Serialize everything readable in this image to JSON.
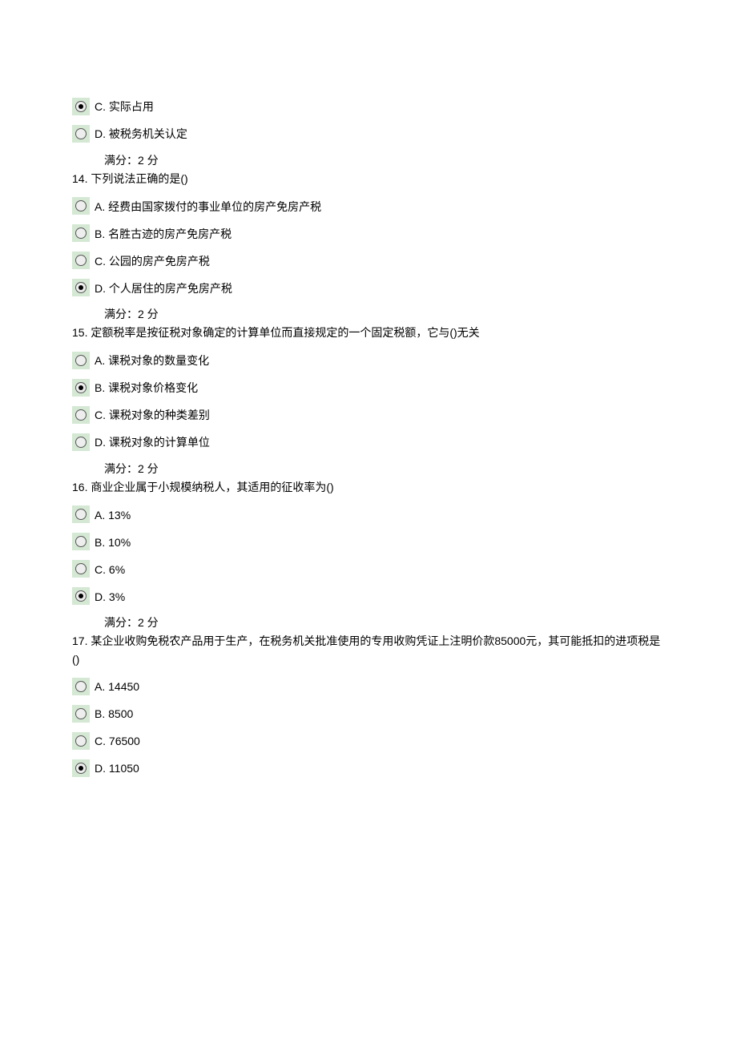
{
  "partialQuestion": {
    "options": [
      {
        "letter": "C",
        "text": "实际占用",
        "selected": true
      },
      {
        "letter": "D",
        "text": "被税务机关认定",
        "selected": false
      }
    ],
    "score": "满分：2 分"
  },
  "questions": [
    {
      "number": "14",
      "stem": "下列说法正确的是()",
      "options": [
        {
          "letter": "A",
          "text": "经费由国家拨付的事业单位的房产免房产税",
          "selected": false
        },
        {
          "letter": "B",
          "text": "名胜古迹的房产免房产税",
          "selected": false
        },
        {
          "letter": "C",
          "text": "公园的房产免房产税",
          "selected": false
        },
        {
          "letter": "D",
          "text": "个人居住的房产免房产税",
          "selected": true
        }
      ],
      "score": "满分：2 分"
    },
    {
      "number": "15",
      "stem": "定额税率是按征税对象确定的计算单位而直接规定的一个固定税额，它与()无关",
      "options": [
        {
          "letter": "A",
          "text": "课税对象的数量变化",
          "selected": false
        },
        {
          "letter": "B",
          "text": "课税对象价格变化",
          "selected": true
        },
        {
          "letter": "C",
          "text": "课税对象的种类差别",
          "selected": false
        },
        {
          "letter": "D",
          "text": "课税对象的计算单位",
          "selected": false
        }
      ],
      "score": "满分：2 分"
    },
    {
      "number": "16",
      "stem": "商业企业属于小规模纳税人，其适用的征收率为()",
      "options": [
        {
          "letter": "A",
          "text": "13%",
          "selected": false
        },
        {
          "letter": "B",
          "text": "10%",
          "selected": false
        },
        {
          "letter": "C",
          "text": "6%",
          "selected": false
        },
        {
          "letter": "D",
          "text": "3%",
          "selected": true
        }
      ],
      "score": "满分：2 分"
    },
    {
      "number": "17",
      "stem": "某企业收购免税农产品用于生产，在税务机关批准使用的专用收购凭证上注明价款85000元，其可能抵扣的进项税是()",
      "options": [
        {
          "letter": "A",
          "text": "14450",
          "selected": false
        },
        {
          "letter": "B",
          "text": "8500",
          "selected": false
        },
        {
          "letter": "C",
          "text": "76500",
          "selected": false
        },
        {
          "letter": "D",
          "text": "11050",
          "selected": true
        }
      ],
      "score": null
    }
  ]
}
